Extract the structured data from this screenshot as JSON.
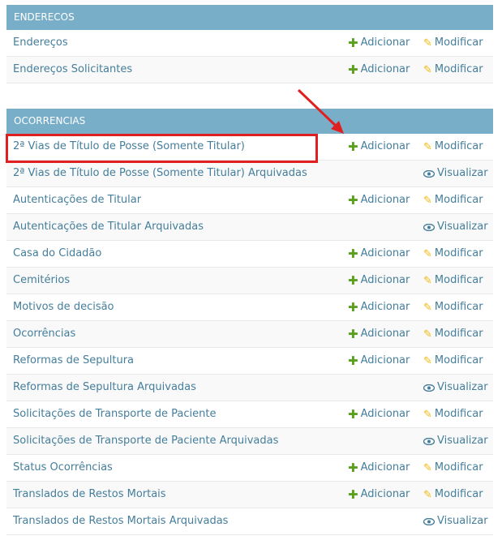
{
  "modules": [
    {
      "title": "ENDERECOS",
      "rows": [
        {
          "label": "Endereços",
          "add": "Adicionar",
          "change": "Modificar"
        },
        {
          "label": "Endereços Solicitantes",
          "add": "Adicionar",
          "change": "Modificar"
        }
      ]
    },
    {
      "title": "OCORRENCIAS",
      "rows": [
        {
          "label": "2ª Vias de Título de Posse (Somente Titular)",
          "add": "Adicionar",
          "change": "Modificar"
        },
        {
          "label": "2ª Vias de Título de Posse (Somente Titular) Arquivadas",
          "view": "Visualizar"
        },
        {
          "label": "Autenticações de Titular",
          "add": "Adicionar",
          "change": "Modificar"
        },
        {
          "label": "Autenticações de Titular Arquivadas",
          "view": "Visualizar"
        },
        {
          "label": "Casa do Cidadão",
          "add": "Adicionar",
          "change": "Modificar"
        },
        {
          "label": "Cemitérios",
          "add": "Adicionar",
          "change": "Modificar"
        },
        {
          "label": "Motivos de decisão",
          "add": "Adicionar",
          "change": "Modificar"
        },
        {
          "label": "Ocorrências",
          "add": "Adicionar",
          "change": "Modificar"
        },
        {
          "label": "Reformas de Sepultura",
          "add": "Adicionar",
          "change": "Modificar"
        },
        {
          "label": "Reformas de Sepultura Arquivadas",
          "view": "Visualizar"
        },
        {
          "label": "Solicitações de Transporte de Paciente",
          "add": "Adicionar",
          "change": "Modificar"
        },
        {
          "label": "Solicitações de Transporte de Paciente Arquivadas",
          "view": "Visualizar"
        },
        {
          "label": "Status Ocorrências",
          "add": "Adicionar",
          "change": "Modificar"
        },
        {
          "label": "Translados de Restos Mortais",
          "add": "Adicionar",
          "change": "Modificar"
        },
        {
          "label": "Translados de Restos Mortais Arquivadas",
          "view": "Visualizar"
        }
      ]
    }
  ],
  "icons": {
    "add": "plus-icon",
    "change": "pencil-icon",
    "view": "eye-icon"
  },
  "colors": {
    "header": "#79aec8",
    "link": "#447e9b",
    "add_icon": "#5aa01e",
    "change_icon": "#efb80b",
    "highlight": "#e02020"
  }
}
